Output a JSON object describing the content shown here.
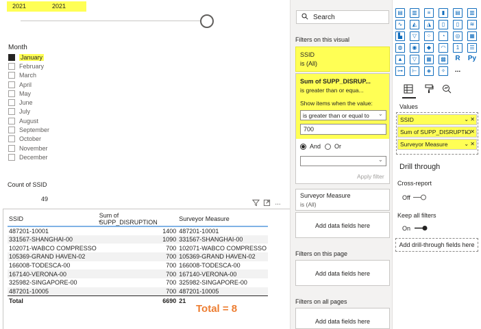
{
  "year_slicer": {
    "start": "2021",
    "end": "2021"
  },
  "month_slicer": {
    "title": "Month",
    "selected": "January",
    "months": [
      "January",
      "February",
      "March",
      "April",
      "May",
      "June",
      "July",
      "August",
      "September",
      "October",
      "November",
      "December"
    ]
  },
  "card": {
    "label": "Count of SSID",
    "value": "49"
  },
  "table": {
    "headers": [
      "SSID",
      "Sum of SUPP_DISRUPTION",
      "Surveyor Measure"
    ],
    "rows": [
      [
        "487201-10001",
        "1400",
        "487201-10001"
      ],
      [
        "331567-SHANGHAI-00",
        "1090",
        "331567-SHANGHAI-00"
      ],
      [
        "102071-WABCO COMPRESSO",
        "700",
        "102071-WABCO COMPRESSO"
      ],
      [
        "105369-GRAND HAVEN-02",
        "700",
        "105369-GRAND HAVEN-02"
      ],
      [
        "166008-TODESCA-00",
        "700",
        "166008-TODESCA-00"
      ],
      [
        "167140-VERONA-00",
        "700",
        "167140-VERONA-00"
      ],
      [
        "325982-SINGAPORE-00",
        "700",
        "325982-SINGAPORE-00"
      ],
      [
        "487201-10005",
        "700",
        "487201-10005"
      ]
    ],
    "total": {
      "label": "Total",
      "sum": "6690",
      "surveyor": "21"
    },
    "annotation": "Total = 8"
  },
  "filters": {
    "search_placeholder": "Search",
    "on_visual_title": "Filters on this visual",
    "ssid_card": {
      "title": "SSID",
      "sub": "is (All)"
    },
    "sum_card": {
      "title": "Sum of SUPP_DISRUP...",
      "sub": "is greater than or equa...",
      "show_items": "Show items when the value:",
      "condition": "is greater than or equal to",
      "value": "700",
      "and_label": "And",
      "or_label": "Or",
      "apply": "Apply filter"
    },
    "surveyor_card": {
      "title": "Surveyor Measure",
      "sub": "is (All)"
    },
    "add_fields": "Add data fields here",
    "on_page_title": "Filters on this page",
    "on_all_title": "Filters on all pages"
  },
  "viz": {
    "values_label": "Values",
    "value_fields": [
      "SSID",
      "Sum of SUPP_DISRUPTIO",
      "Surveyor Measure"
    ],
    "drill_title": "Drill through",
    "cross_report": "Cross-report",
    "cross_state": "Off",
    "keep_filters": "Keep all filters",
    "keep_state": "On",
    "drill_add": "Add drill-through fields here",
    "r_label": "R",
    "py_label": "Py",
    "more_label": "..."
  },
  "colors": {
    "highlight": "#ffff55",
    "accent": "#0f6cbd",
    "annotation": "#ed7d31"
  }
}
